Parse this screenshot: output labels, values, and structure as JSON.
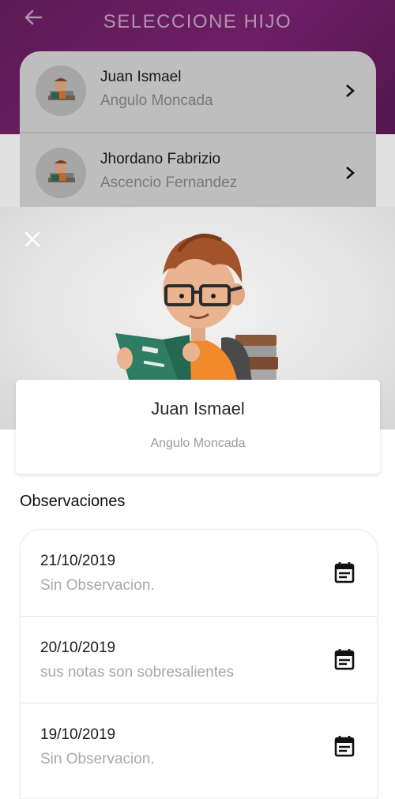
{
  "header": {
    "title": "SELECCIONE HIJO"
  },
  "background_list": [
    {
      "first": "Juan Ismael",
      "last": "Angulo Moncada"
    },
    {
      "first": "Jhordano Fabrizio",
      "last": "Ascencio Fernandez"
    }
  ],
  "detail": {
    "name": "Juan Ismael",
    "surname": "Angulo Moncada",
    "section_title": "Observaciones",
    "observations": [
      {
        "date": "21/10/2019",
        "text": "Sin Observacion."
      },
      {
        "date": "20/10/2019",
        "text": "sus notas son sobresalientes"
      },
      {
        "date": "19/10/2019",
        "text": "Sin Observacion."
      }
    ]
  },
  "colors": {
    "header": "#7d2375",
    "hero": "#e4e4e4",
    "accent_shirt": "#f2892e",
    "book": "#2e7d62"
  },
  "icons": [
    "back-arrow-icon",
    "chevron-right-icon",
    "close-icon",
    "calendar-icon"
  ]
}
